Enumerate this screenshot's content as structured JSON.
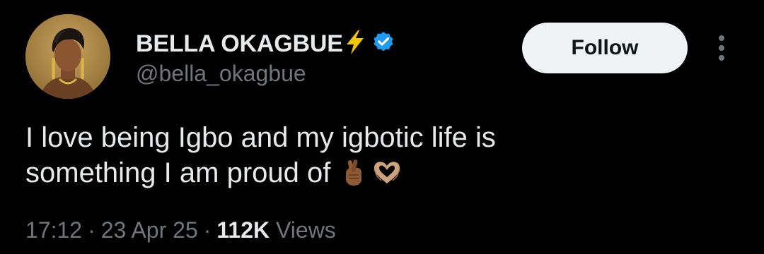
{
  "profile": {
    "display_name": "BELLA OKAGBUE",
    "handle": "@bella_okagbue",
    "name_emoji_icon": "lightning-bolt-icon",
    "verified_icon": "verified-badge-icon",
    "verified_color": "#1d9bf0",
    "avatar_icon": "profile-photo"
  },
  "actions": {
    "follow_label": "Follow",
    "more_icon": "more-vertical-icon"
  },
  "tweet": {
    "line1": "I love being Igbo and my igbotic life is",
    "line2": "something I am proud of",
    "emojis": [
      "crossed-fingers-emoji",
      "heart-hands-emoji"
    ]
  },
  "meta": {
    "time": "17:12",
    "separator": "·",
    "date": "23 Apr 25",
    "views_count": "112K",
    "views_label": "Views"
  },
  "colors": {
    "background": "#000000",
    "primary_text": "#e7e9ea",
    "secondary_text": "#71767b",
    "button_bg": "#eff3f4",
    "button_text": "#0f1419",
    "bolt": "#f5c400"
  }
}
